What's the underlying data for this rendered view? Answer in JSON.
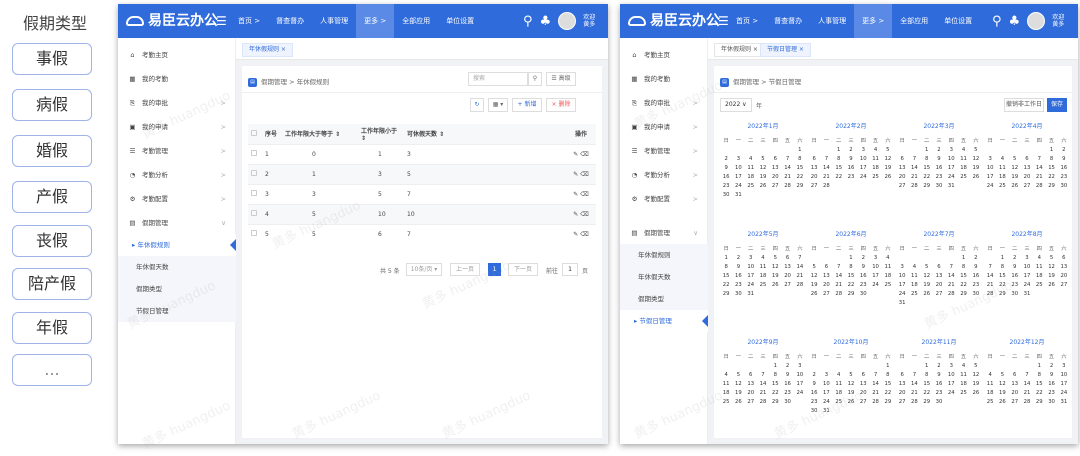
{
  "leave_types": {
    "title": "假期类型",
    "items": [
      "事假",
      "病假",
      "婚假",
      "产假",
      "丧假",
      "陪产假",
      "年假",
      "..."
    ]
  },
  "app": {
    "logo": "易臣云办公",
    "menu_icon": "☰",
    "nav": [
      "首页 >",
      "督查督办",
      "人事管理",
      "更多 >",
      "全部应用",
      "单位设置"
    ],
    "nav_active_index": 3,
    "welcome": "欢迎",
    "user": "黄多",
    "watermark": "黄多 huangduo"
  },
  "sidebar": [
    {
      "label": "考勤主页",
      "icon": "⌂"
    },
    {
      "label": "我的考勤",
      "icon": "▦"
    },
    {
      "label": "我的审批",
      "icon": "⎘",
      "arrow": ">"
    },
    {
      "label": "我的申请",
      "icon": "▣",
      "arrow": ">"
    },
    {
      "label": "考勤管理",
      "icon": "☰",
      "arrow": ">"
    },
    {
      "label": "考勤分析",
      "icon": "◔",
      "arrow": ">"
    },
    {
      "label": "考勤配置",
      "icon": "⚙",
      "arrow": ">"
    },
    {
      "label": "假期管理",
      "icon": "▤",
      "arrow": "∨"
    }
  ],
  "subitems": [
    "年休假规则",
    "年休假天数",
    "假期类型",
    "节假日管理"
  ],
  "left_panel": {
    "tab": "年休假规则 ×",
    "breadcrumb": "假期管理 > 年休假规则",
    "search_placeholder": "搜索",
    "search_icon": "⚲",
    "advanced": "☰ 高级",
    "refresh": "↻",
    "columns_btn": "▦ ▾",
    "add": "+ 新增",
    "delete": "× 删除",
    "headers": [
      "序号",
      "工作年限大于等于 ⇕",
      "工作年限小于 ⇕",
      "可休假天数 ⇕",
      "操作"
    ],
    "rows": [
      [
        "1",
        "0",
        "1",
        "3"
      ],
      [
        "2",
        "1",
        "3",
        "5"
      ],
      [
        "3",
        "3",
        "5",
        "7"
      ],
      [
        "4",
        "5",
        "10",
        "10"
      ],
      [
        "5",
        "5",
        "6",
        "7"
      ]
    ],
    "row_actions": "✎ ⌫",
    "pager": {
      "total": "共 5 条",
      "per_page": "10条/页 ▾",
      "prev": "上一页",
      "page": "1",
      "next": "下一页",
      "goto": "前往",
      "goto_value": "1",
      "unit": "页"
    }
  },
  "right_panel": {
    "tabs": [
      "年休假规则 ×",
      "节假日管理 ×"
    ],
    "breadcrumb": "假期管理 > 节假日管理",
    "year": "2022 ∨",
    "year_unit": "年",
    "reset_btn": "撤销非工作日",
    "save_btn": "保存",
    "weekdays": [
      "日",
      "一",
      "二",
      "三",
      "四",
      "五",
      "六"
    ],
    "months": [
      {
        "title": "2022年1月",
        "offset": 6,
        "days": 31
      },
      {
        "title": "2022年2月",
        "offset": 2,
        "days": 28
      },
      {
        "title": "2022年3月",
        "offset": 2,
        "days": 31
      },
      {
        "title": "2022年4月",
        "offset": 5,
        "days": 30
      },
      {
        "title": "2022年5月",
        "offset": 0,
        "days": 31
      },
      {
        "title": "2022年6月",
        "offset": 3,
        "days": 30
      },
      {
        "title": "2022年7月",
        "offset": 5,
        "days": 31
      },
      {
        "title": "2022年8月",
        "offset": 1,
        "days": 31
      },
      {
        "title": "2022年9月",
        "offset": 4,
        "days": 30
      },
      {
        "title": "2022年10月",
        "offset": 6,
        "days": 31
      },
      {
        "title": "2022年11月",
        "offset": 2,
        "days": 30
      },
      {
        "title": "2022年12月",
        "offset": 4,
        "days": 31
      }
    ]
  }
}
